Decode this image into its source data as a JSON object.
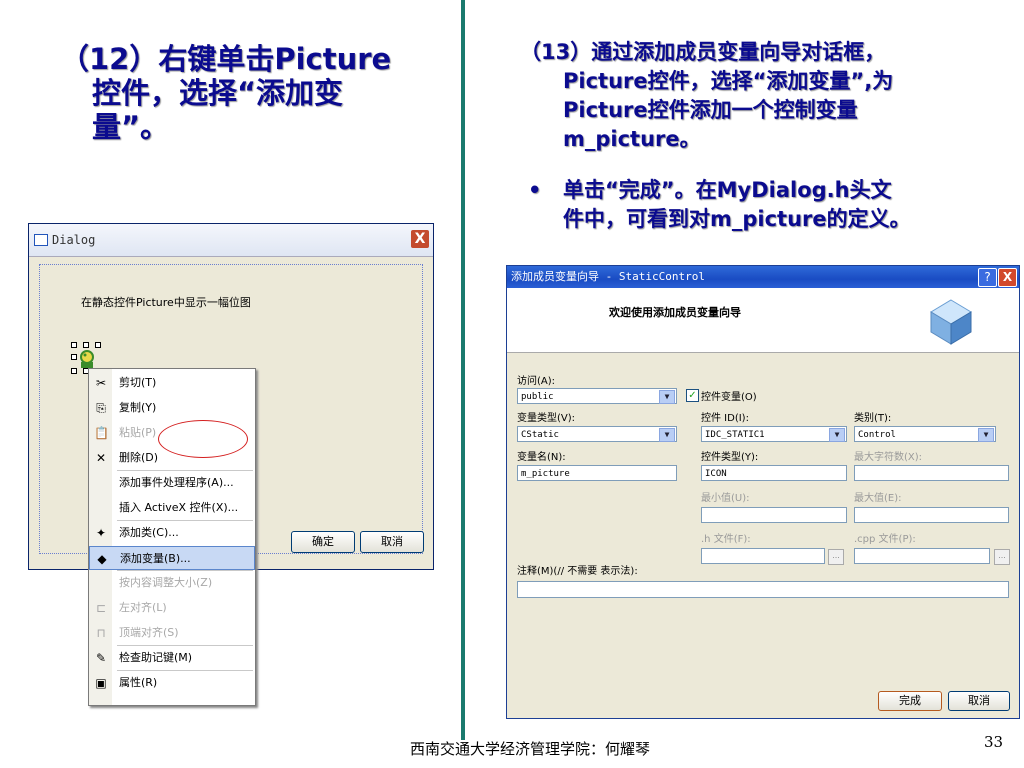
{
  "slide": {
    "step12": [
      "（12）右键单击Picture",
      "控件，选择“添加变",
      "量”。"
    ],
    "step13": [
      "（13）通过添加成员变量向导对话框，",
      "Picture控件，选择“添加变量”,为",
      "Picture控件添加一个控制变量",
      "m_picture。"
    ],
    "bullet_mark": "•",
    "bullet": [
      "单击“完成”。在MyDialog.h头文",
      "件中，可看到对m_picture的定义。"
    ],
    "footer": "西南交通大学经济管理学院：何耀琴",
    "page": "33"
  },
  "left_dialog": {
    "title": "Dialog",
    "close": "X",
    "static_text": "在静态控件Picture中显示一幅位图",
    "ok": "确定",
    "cancel": "取消"
  },
  "context_menu": {
    "items": [
      {
        "label": "剪切(T)",
        "icon": "scissors-icon",
        "glyph": "✂",
        "disabled": false
      },
      {
        "label": "复制(Y)",
        "icon": "copy-icon",
        "glyph": "⎘",
        "disabled": false
      },
      {
        "label": "粘贴(P)",
        "icon": "paste-icon",
        "glyph": "📋",
        "disabled": true
      },
      {
        "label": "删除(D)",
        "icon": "delete-icon",
        "glyph": "✕",
        "disabled": false
      },
      {
        "label": "添加事件处理程序(A)...",
        "icon": "",
        "glyph": "",
        "disabled": false
      },
      {
        "label": "插入 ActiveX 控件(X)...",
        "icon": "",
        "glyph": "",
        "disabled": false
      },
      {
        "label": "添加类(C)...",
        "icon": "add-class-icon",
        "glyph": "✦",
        "disabled": false
      },
      {
        "label": "添加变量(B)...",
        "icon": "add-variable-icon",
        "glyph": "◆",
        "disabled": false,
        "selected": true
      },
      {
        "label": "按内容调整大小(Z)",
        "icon": "",
        "glyph": "",
        "disabled": true
      },
      {
        "label": "左对齐(L)",
        "icon": "align-left-icon",
        "glyph": "⊏",
        "disabled": true
      },
      {
        "label": "顶端对齐(S)",
        "icon": "align-top-icon",
        "glyph": "⊓",
        "disabled": true
      },
      {
        "label": "检查助记键(M)",
        "icon": "check-mnemonic-icon",
        "glyph": "✎",
        "disabled": false
      },
      {
        "label": "属性(R)",
        "icon": "properties-icon",
        "glyph": "▣",
        "disabled": false
      }
    ]
  },
  "wizard": {
    "title": "添加成员变量向导 - StaticControl",
    "help": "?",
    "close": "X",
    "header": "欢迎使用添加成员变量向导",
    "access_label": "访问(A):",
    "access_value": "public",
    "control_var_label": "控件变量(O)",
    "control_var_checked": "✓",
    "var_type_label": "变量类型(V):",
    "var_type_value": "CStatic",
    "control_id_label": "控件 ID(I):",
    "control_id_value": "IDC_STATIC1",
    "category_label": "类别(T):",
    "category_value": "Control",
    "var_name_label": "变量名(N):",
    "var_name_value": "m_picture",
    "control_type_label": "控件类型(Y):",
    "control_type_value": "ICON",
    "max_chars_label": "最大字符数(X):",
    "min_label": "最小值(U):",
    "max_label": "最大值(E):",
    "h_file_label": ".h 文件(F):",
    "cpp_file_label": ".cpp 文件(P):",
    "browse": "...",
    "comment_label": "注释(M)(// 不需要 表示法):",
    "finish": "完成",
    "cancel": "取消",
    "dropdown_glyph": "▼"
  },
  "colors": {
    "slide_text": "#0b0b8f",
    "divider": "#1a7a6e",
    "highlight": "#d42020"
  }
}
